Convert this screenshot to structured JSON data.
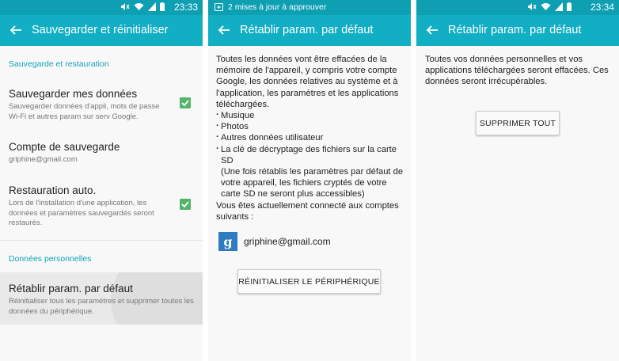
{
  "status": {
    "time_1": "23:33",
    "time_3": "23:34",
    "notification": "2 mises à jour à approuver"
  },
  "screen1": {
    "title": "Sauvegarder et réinitialiser",
    "section1": "Sauvegarde et restauration",
    "items": [
      {
        "title": "Sauvegarder mes données",
        "subtitle": "Sauvegarder données d'appli, mots de passe Wi-Fi et autres param sur serv Google.",
        "checked": true
      },
      {
        "title": "Compte de sauvegarde",
        "subtitle": "griphine@gmail.com"
      },
      {
        "title": "Restauration auto.",
        "subtitle": "Lors de l'installation d'une application, les données et paramètres sauvegardés seront restaurés.",
        "checked": true
      }
    ],
    "section2": "Données personnelles",
    "reset_item": {
      "title": "Rétablir param. par défaut",
      "subtitle": "Réinitialiser tous les paramètres et supprimer toutes les données du périphérique."
    }
  },
  "screen2": {
    "title": "Rétablir param. par défaut",
    "intro": "Toutes les données vont être effacées de la mémoire de l'appareil, y compris votre compte Google, les données relatives au système et à l'application, les paramètres et les applications téléchargées.",
    "bullets": [
      "Musique",
      "Photos",
      "Autres données utilisateur",
      "La clé de décryptage des fichiers sur la carte SD"
    ],
    "note": "(Une fois rétablis les paramètres par défaut de votre appareil, les fichiers cryptés de votre carte SD ne seront plus accessibles)",
    "connected_text": "Vous êtes actuellement connecté aux comptes suivants :",
    "account_email": "griphine@gmail.com",
    "google_letter": "g",
    "button": "RÉINITIALISER LE PÉRIPHÉRIQUE"
  },
  "screen3": {
    "title": "Rétablir param. par défaut",
    "text": "Toutes vos données personnelles et vos applications téléchargées seront effacées. Ces données seront irrécupérables.",
    "button": "SUPPRIMER TOUT"
  },
  "colors": {
    "statusbar": "#0f9fb3",
    "appbar": "#12aec4",
    "accent_text": "#13a3b8",
    "checkbox": "#54b46a"
  }
}
